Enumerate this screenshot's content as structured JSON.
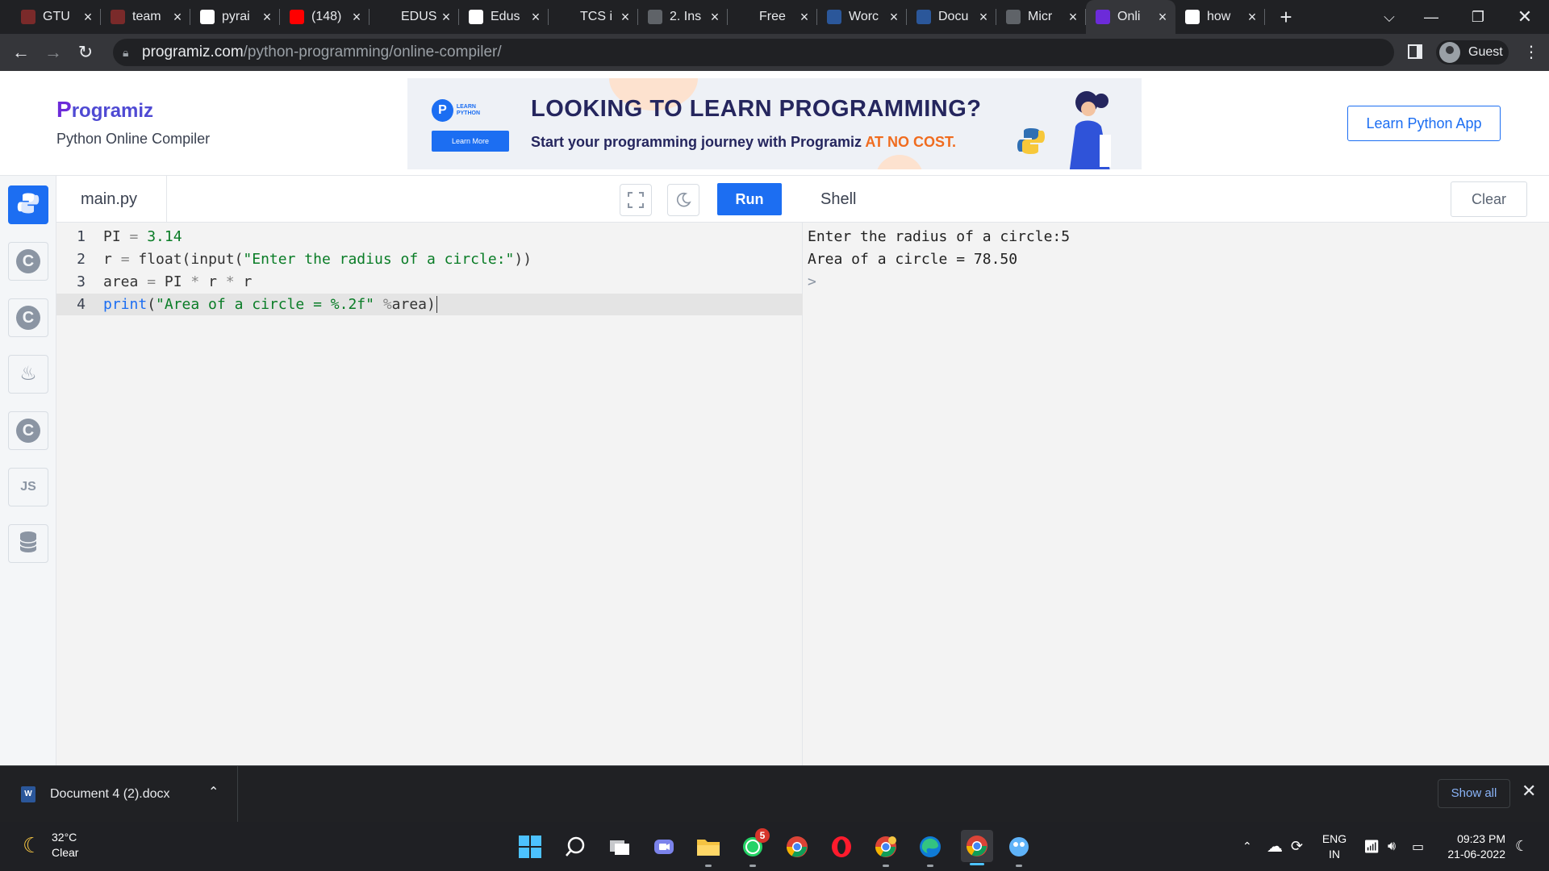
{
  "browser": {
    "tabs": [
      {
        "label": "GTU",
        "icon": "gtu-favicon",
        "color": "#7a2a2a"
      },
      {
        "label": "team",
        "icon": "team-favicon",
        "color": "#7a2a2a"
      },
      {
        "label": "pyrai",
        "icon": "google-favicon",
        "color": "#ffffff"
      },
      {
        "label": "(148)",
        "icon": "youtube-favicon",
        "color": "#ff0000"
      },
      {
        "label": "EDUS",
        "icon": "irs-favicon",
        "color": "#202124"
      },
      {
        "label": "Edus",
        "icon": "edus-favicon",
        "color": "#ffffff"
      },
      {
        "label": "TCS i",
        "icon": "power-favicon",
        "color": "#202124"
      },
      {
        "label": "2. Ins",
        "icon": "book-favicon",
        "color": "#5f6368"
      },
      {
        "label": "Free",
        "icon": "n-favicon",
        "color": "#202124"
      },
      {
        "label": "Worc",
        "icon": "word-favicon",
        "color": "#2b579a"
      },
      {
        "label": "Docu",
        "icon": "word-favicon",
        "color": "#2b579a"
      },
      {
        "label": "Micr",
        "icon": "globe-favicon",
        "color": "#5f6368"
      },
      {
        "label": "Onli",
        "icon": "programiz-favicon",
        "color": "#6c2bd9",
        "active": true
      },
      {
        "label": "how",
        "icon": "google-favicon",
        "color": "#ffffff"
      }
    ],
    "new_tab": "+",
    "url_host": "programiz.com",
    "url_path": "/python-programming/online-compiler/",
    "profile_label": "Guest"
  },
  "site": {
    "logo_text": "rogramiz",
    "logo_mark": "P",
    "subtitle": "Python Online Compiler",
    "banner": {
      "badge_line1": "LEARN",
      "badge_line2": "PYTHON",
      "learn_more": "Learn More",
      "headline": "LOOKING TO LEARN PROGRAMMING?",
      "tagline_main": "Start your programming journey with Programiz ",
      "tagline_accent": "AT NO COST."
    },
    "learn_app_button": "Learn Python App"
  },
  "rail": {
    "items": [
      {
        "name": "python",
        "icon": "python-icon",
        "label": "",
        "active": true
      },
      {
        "name": "c",
        "icon": "c-icon",
        "label": "C"
      },
      {
        "name": "cpp",
        "icon": "cpp-icon",
        "label": "C"
      },
      {
        "name": "java",
        "icon": "java-icon",
        "label": "♨"
      },
      {
        "name": "csharp",
        "icon": "csharp-icon",
        "label": "C"
      },
      {
        "name": "js",
        "icon": "js-icon",
        "label": "JS"
      },
      {
        "name": "sql",
        "icon": "database-icon",
        "label": ""
      }
    ]
  },
  "editor": {
    "filename": "main.py",
    "run_label": "Run",
    "lines": [
      {
        "n": "1",
        "parts": [
          [
            "t",
            "PI "
          ],
          [
            "o",
            "= "
          ],
          [
            "n",
            "3.14"
          ]
        ]
      },
      {
        "n": "2",
        "parts": [
          [
            "t",
            "r "
          ],
          [
            "o",
            "= "
          ],
          [
            "t",
            "float(input("
          ],
          [
            "s",
            "\"Enter the radius of a circle:\""
          ],
          [
            "t",
            "))"
          ]
        ]
      },
      {
        "n": "3",
        "parts": [
          [
            "t",
            "area "
          ],
          [
            "o",
            "= "
          ],
          [
            "t",
            "PI "
          ],
          [
            "o",
            "* "
          ],
          [
            "t",
            "r "
          ],
          [
            "o",
            "* "
          ],
          [
            "t",
            "r"
          ]
        ]
      },
      {
        "n": "4",
        "parts": [
          [
            "f",
            "print"
          ],
          [
            "t",
            "("
          ],
          [
            "s",
            "\"Area of a circle = %.2f\""
          ],
          [
            "t",
            " "
          ],
          [
            "o",
            "%"
          ],
          [
            "t",
            "area)"
          ]
        ],
        "current": true
      }
    ]
  },
  "shell": {
    "title": "Shell",
    "clear_label": "Clear",
    "output": [
      "Enter the radius of a circle:5",
      "Area of a circle = 78.50",
      ">"
    ]
  },
  "downloads": {
    "file": "Document 4 (2).docx",
    "show_all": "Show all"
  },
  "taskbar": {
    "temperature": "32°C",
    "condition": "Clear",
    "whatsapp_badge": "5",
    "lang_line1": "ENG",
    "lang_line2": "IN",
    "time": "09:23 PM",
    "date": "21-06-2022"
  }
}
